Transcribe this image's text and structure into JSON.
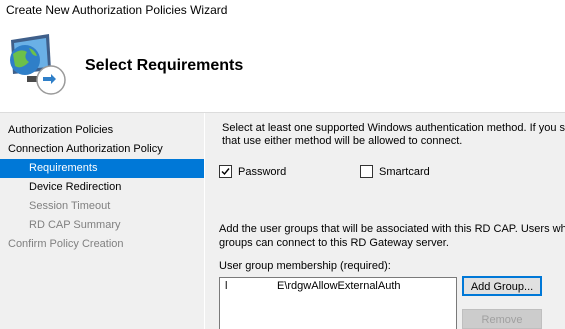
{
  "window": {
    "title": "Create New Authorization Policies Wizard"
  },
  "header": {
    "title": "Select Requirements",
    "icon": "rd-gateway-wizard-icon"
  },
  "nav": {
    "items": [
      {
        "label": "Authorization Policies",
        "level": 0,
        "state": "normal"
      },
      {
        "label": "Connection Authorization Policy",
        "level": 0,
        "state": "normal"
      },
      {
        "label": "Requirements",
        "level": 1,
        "state": "selected"
      },
      {
        "label": "Device Redirection",
        "level": 1,
        "state": "normal"
      },
      {
        "label": "Session Timeout",
        "level": 1,
        "state": "disabled"
      },
      {
        "label": "RD CAP Summary",
        "level": 1,
        "state": "disabled"
      },
      {
        "label": "Confirm Policy Creation",
        "level": 0,
        "state": "disabled"
      }
    ]
  },
  "auth": {
    "desc_line1": "Select at least one supported Windows authentication method. If you sele",
    "desc_line2": "that use either method will be allowed to connect.",
    "password_label": "Password",
    "password_checked": true,
    "smartcard_label": "Smartcard",
    "smartcard_checked": false
  },
  "groups": {
    "desc_line1": "Add the user groups that will be associated with this RD CAP. Users who a",
    "desc_line2": "groups can connect to this RD Gateway server.",
    "list_label": "User group membership (required):",
    "entries": [
      {
        "domain": "l",
        "name": "E\\rdgwAllowExternalAuth"
      }
    ],
    "add_button": "Add Group...",
    "remove_button": "Remove"
  },
  "colors": {
    "selection": "#0078d7",
    "panel": "#f0f0f0",
    "disabled_text": "#808080"
  }
}
